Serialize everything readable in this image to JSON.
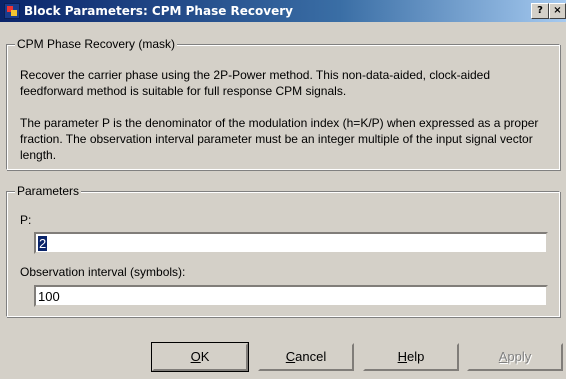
{
  "window": {
    "title": "Block Parameters: CPM Phase Recovery",
    "help_button": "?",
    "close_button": "×",
    "icon": "simulink-block-icon"
  },
  "description": {
    "group_label": "CPM Phase Recovery (mask)",
    "paragraph_1": "Recover the carrier phase using the 2P-Power method.  This non-data-aided, clock-aided feedforward method is suitable for full response CPM signals.",
    "paragraph_2": "The parameter P is the denominator of the modulation index (h=K/P) when expressed as a proper fraction. The observation interval parameter must be an integer multiple of the input signal vector length."
  },
  "parameters": {
    "group_label": "Parameters",
    "p_label": "P:",
    "p_value": "2",
    "interval_label": "Observation interval (symbols):",
    "interval_value": "100"
  },
  "buttons": {
    "ok": {
      "label": "OK",
      "mnemonic": "O",
      "rest": "K"
    },
    "cancel": {
      "label": "Cancel",
      "mnemonic": "C",
      "rest": "ancel"
    },
    "help": {
      "label": "Help",
      "mnemonic": "H",
      "rest": "elp"
    },
    "apply": {
      "label": "Apply",
      "mnemonic": "A",
      "rest": "pply",
      "enabled": false
    }
  }
}
